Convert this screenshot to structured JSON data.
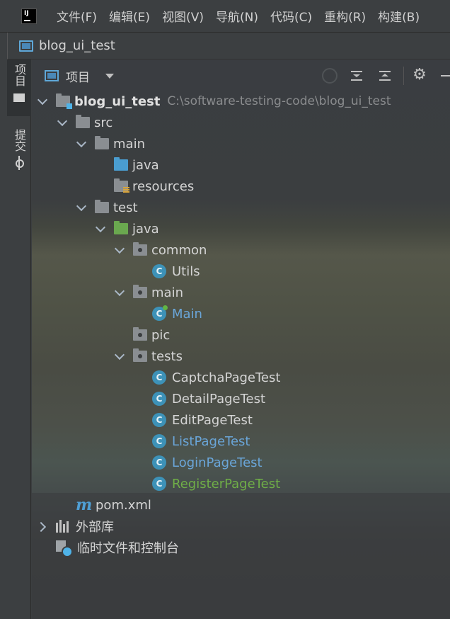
{
  "menubar": {
    "items": [
      "文件(F)",
      "编辑(E)",
      "视图(V)",
      "导航(N)",
      "代码(C)",
      "重构(R)",
      "构建(B)"
    ]
  },
  "navbar": {
    "project_name": "blog_ui_test"
  },
  "stripe": {
    "project_tab": "项目",
    "commit_tab": "提交"
  },
  "panel": {
    "title": "项目"
  },
  "tree": {
    "root": {
      "label": "blog_ui_test",
      "path": "C:\\software-testing-code\\blog_ui_test"
    },
    "src": "src",
    "main": "main",
    "java_main": "java",
    "resources": "resources",
    "test": "test",
    "java_test": "java",
    "common": "common",
    "utils": "Utils",
    "main_pkg": "main",
    "main_class": "Main",
    "pic": "pic",
    "tests": "tests",
    "test_classes": [
      "CaptchaPageTest",
      "DetailPageTest",
      "EditPageTest",
      "ListPageTest",
      "LoginPageTest",
      "RegisterPageTest"
    ],
    "pom": "pom.xml",
    "external_libs": "外部库",
    "scratches": "临时文件和控制台",
    "class_icon_letter": "C"
  },
  "colors": {
    "default_text": "#d4d4d4",
    "modified_blue": "#6aa5d8",
    "added_green": "#6fae47",
    "class_icon": "#3d92b8",
    "test_folder": "#6aa84f",
    "source_folder": "#4a9dd0"
  }
}
